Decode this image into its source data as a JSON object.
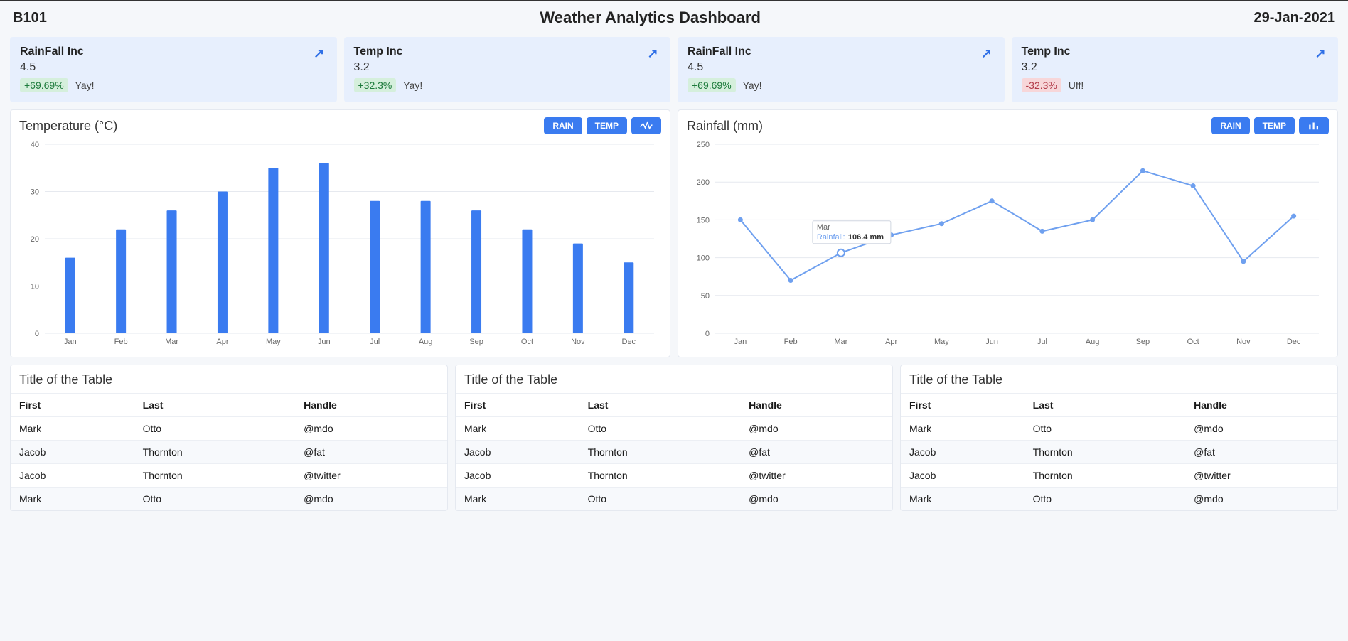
{
  "header": {
    "left": "B101",
    "center": "Weather Analytics Dashboard",
    "right": "29-Jan-2021"
  },
  "cards": [
    {
      "title": "RainFall Inc",
      "value": "4.5",
      "delta": "+69.69%",
      "delta_style": "green",
      "note": "Yay!"
    },
    {
      "title": "Temp Inc",
      "value": "3.2",
      "delta": "+32.3%",
      "delta_style": "green",
      "note": "Yay!"
    },
    {
      "title": "RainFall Inc",
      "value": "4.5",
      "delta": "+69.69%",
      "delta_style": "green",
      "note": "Yay!"
    },
    {
      "title": "Temp Inc",
      "value": "3.2",
      "delta": "-32.3%",
      "delta_style": "red",
      "note": "Uff!"
    }
  ],
  "buttons": {
    "rain": "RAIN",
    "temp": "TEMP"
  },
  "chart_data": [
    {
      "type": "bar",
      "title": "Temperature (°C)",
      "categories": [
        "Jan",
        "Feb",
        "Mar",
        "Apr",
        "May",
        "Jun",
        "Jul",
        "Aug",
        "Sep",
        "Oct",
        "Nov",
        "Dec"
      ],
      "values": [
        16,
        22,
        26,
        30,
        35,
        36,
        28,
        28,
        26,
        22,
        19,
        15
      ],
      "ylim": [
        0,
        40
      ],
      "yticks": [
        0,
        10,
        20,
        30,
        40
      ],
      "ylabel": "",
      "xlabel": ""
    },
    {
      "type": "line",
      "title": "Rainfall (mm)",
      "categories": [
        "Jan",
        "Feb",
        "Mar",
        "Apr",
        "May",
        "Jun",
        "Jul",
        "Aug",
        "Sep",
        "Oct",
        "Nov",
        "Dec"
      ],
      "values": [
        150,
        70,
        106.4,
        130,
        145,
        175,
        135,
        150,
        215,
        195,
        95,
        155
      ],
      "ylim": [
        0,
        250
      ],
      "yticks": [
        0,
        50,
        100,
        150,
        200,
        250
      ],
      "ylabel": "",
      "xlabel": "",
      "tooltip": {
        "index": 2,
        "month": "Mar",
        "label": "Rainfall:",
        "value": "106.4 mm"
      }
    }
  ],
  "tables": [
    {
      "title": "Title of the Table",
      "columns": [
        "First",
        "Last",
        "Handle"
      ],
      "rows": [
        [
          "Mark",
          "Otto",
          "@mdo"
        ],
        [
          "Jacob",
          "Thornton",
          "@fat"
        ],
        [
          "Jacob",
          "Thornton",
          "@twitter"
        ],
        [
          "Mark",
          "Otto",
          "@mdo"
        ]
      ]
    },
    {
      "title": "Title of the Table",
      "columns": [
        "First",
        "Last",
        "Handle"
      ],
      "rows": [
        [
          "Mark",
          "Otto",
          "@mdo"
        ],
        [
          "Jacob",
          "Thornton",
          "@fat"
        ],
        [
          "Jacob",
          "Thornton",
          "@twitter"
        ],
        [
          "Mark",
          "Otto",
          "@mdo"
        ]
      ]
    },
    {
      "title": "Title of the Table",
      "columns": [
        "First",
        "Last",
        "Handle"
      ],
      "rows": [
        [
          "Mark",
          "Otto",
          "@mdo"
        ],
        [
          "Jacob",
          "Thornton",
          "@fat"
        ],
        [
          "Jacob",
          "Thornton",
          "@twitter"
        ],
        [
          "Mark",
          "Otto",
          "@mdo"
        ]
      ]
    }
  ]
}
